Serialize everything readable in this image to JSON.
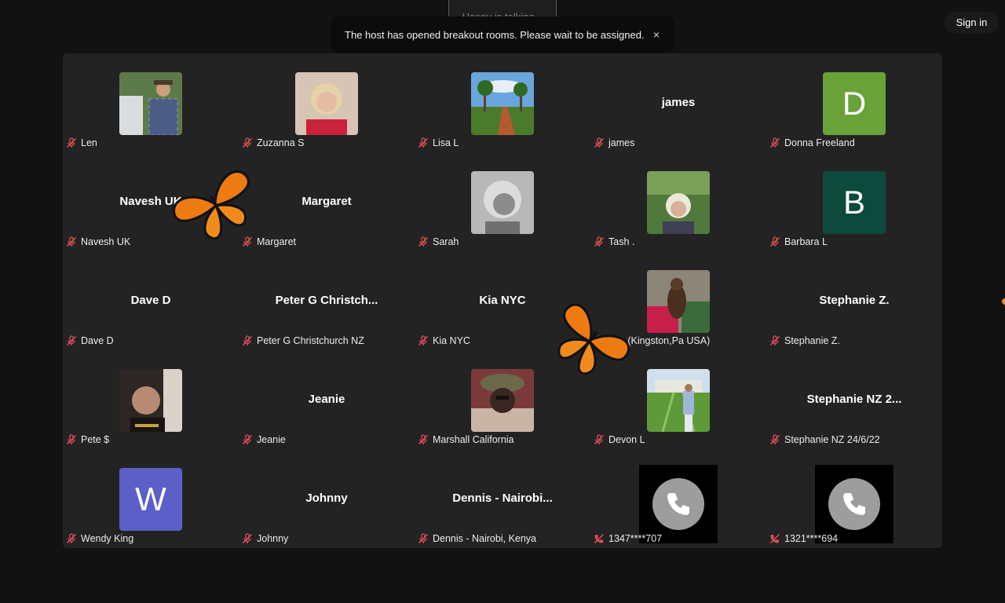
{
  "top": {
    "talking_indicator": "Happy is talking..."
  },
  "toast": {
    "message": "The host has opened breakout rooms. Please wait to be assigned.",
    "close_label": "×"
  },
  "signin": {
    "label": "Sign in"
  },
  "colors": {
    "accent_orange": "#f08a1c",
    "mute_red": "#e0505b",
    "avatar_green": "#6aa23a",
    "avatar_teal": "#0d4a3c",
    "avatar_purple": "#5b5fc7"
  },
  "tiles": [
    {
      "name": "Len",
      "type": "photo",
      "photo": "man-with-hat"
    },
    {
      "name": "Zuzanna S",
      "type": "photo",
      "photo": "woman-blonde-red"
    },
    {
      "name": "Lisa L",
      "type": "photo",
      "photo": "palm-tree-road"
    },
    {
      "name": "james",
      "type": "title",
      "title": "james"
    },
    {
      "name": "Donna Freeland",
      "type": "letter",
      "letter": "D",
      "color": "#6aa23a"
    },
    {
      "name": "Navesh UK",
      "type": "title",
      "title": "Navesh UK"
    },
    {
      "name": "Margaret",
      "type": "title",
      "title": "Margaret"
    },
    {
      "name": "Sarah",
      "type": "photo",
      "photo": "woman-grayscale"
    },
    {
      "name": "Tash .",
      "type": "photo",
      "photo": "woman-garden"
    },
    {
      "name": "Barbara L",
      "type": "letter",
      "letter": "B",
      "color": "#0d4a3c"
    },
    {
      "name": "Dave D",
      "type": "title",
      "title": "Dave D"
    },
    {
      "name": "Peter G Christchurch NZ",
      "type": "title",
      "title": "Peter G Christch..."
    },
    {
      "name": "Kia NYC",
      "type": "title",
      "title": "Kia NYC"
    },
    {
      "name": "ghn (Kingston,Pa USA)",
      "type": "photo",
      "photo": "dog-on-porch"
    },
    {
      "name": "Stephanie Z.",
      "type": "title",
      "title": "Stephanie Z."
    },
    {
      "name": "Pete $",
      "type": "photo",
      "photo": "man-reclining"
    },
    {
      "name": "Jeanie",
      "type": "title",
      "title": "Jeanie"
    },
    {
      "name": "Marshall California",
      "type": "photo",
      "photo": "man-bucket-hat"
    },
    {
      "name": "Devon L",
      "type": "photo",
      "photo": "woman-lawn"
    },
    {
      "name": "Stephanie NZ 24/6/22",
      "type": "title",
      "title": "Stephanie NZ 2..."
    },
    {
      "name": "Wendy King",
      "type": "letter",
      "letter": "W",
      "color": "#5b5fc7"
    },
    {
      "name": "Johnny",
      "type": "title",
      "title": "Johnny"
    },
    {
      "name": "Dennis - Nairobi, Kenya",
      "type": "title",
      "title": "Dennis - Nairobi..."
    },
    {
      "name": "1347****707",
      "type": "phone"
    },
    {
      "name": "1321****694",
      "type": "phone"
    }
  ]
}
